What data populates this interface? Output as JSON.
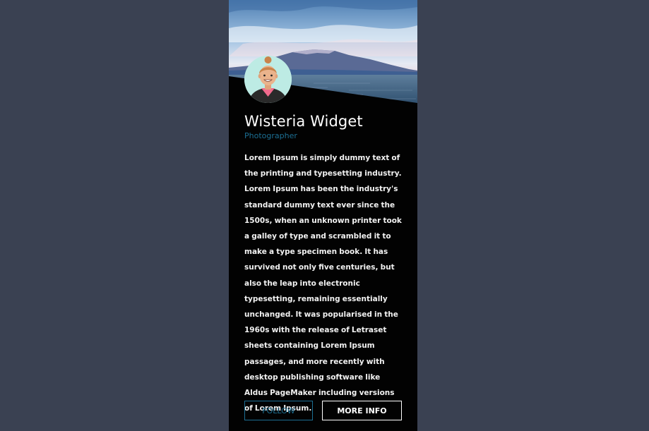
{
  "profile": {
    "name": "Wisteria Widget",
    "role": "Photographer",
    "bio": "Lorem Ipsum is simply dummy text of the printing and typesetting industry. Lorem Ipsum has been the industry's standard dummy text ever since the 1500s, when an unknown printer took a galley of type and scrambled it to make a type specimen book. It has survived not only five centuries, but also the leap into electronic typesetting, remaining essentially unchanged. It was popularised in the 1960s with the release of Letraset sheets containing Lorem Ipsum passages, and more recently with desktop publishing software like Aldus PageMaker including versions of Lorem Ipsum."
  },
  "actions": {
    "follow_label": "FOLLOW",
    "more_info_label": "MORE INFO"
  },
  "colors": {
    "page_background": "#3a4152",
    "card_background": "#020202",
    "accent": "#1c6f93",
    "avatar_background": "#bdebe4"
  },
  "images": {
    "cover": "mountain-lake-photo",
    "avatar": "smiling-person-avatar"
  }
}
